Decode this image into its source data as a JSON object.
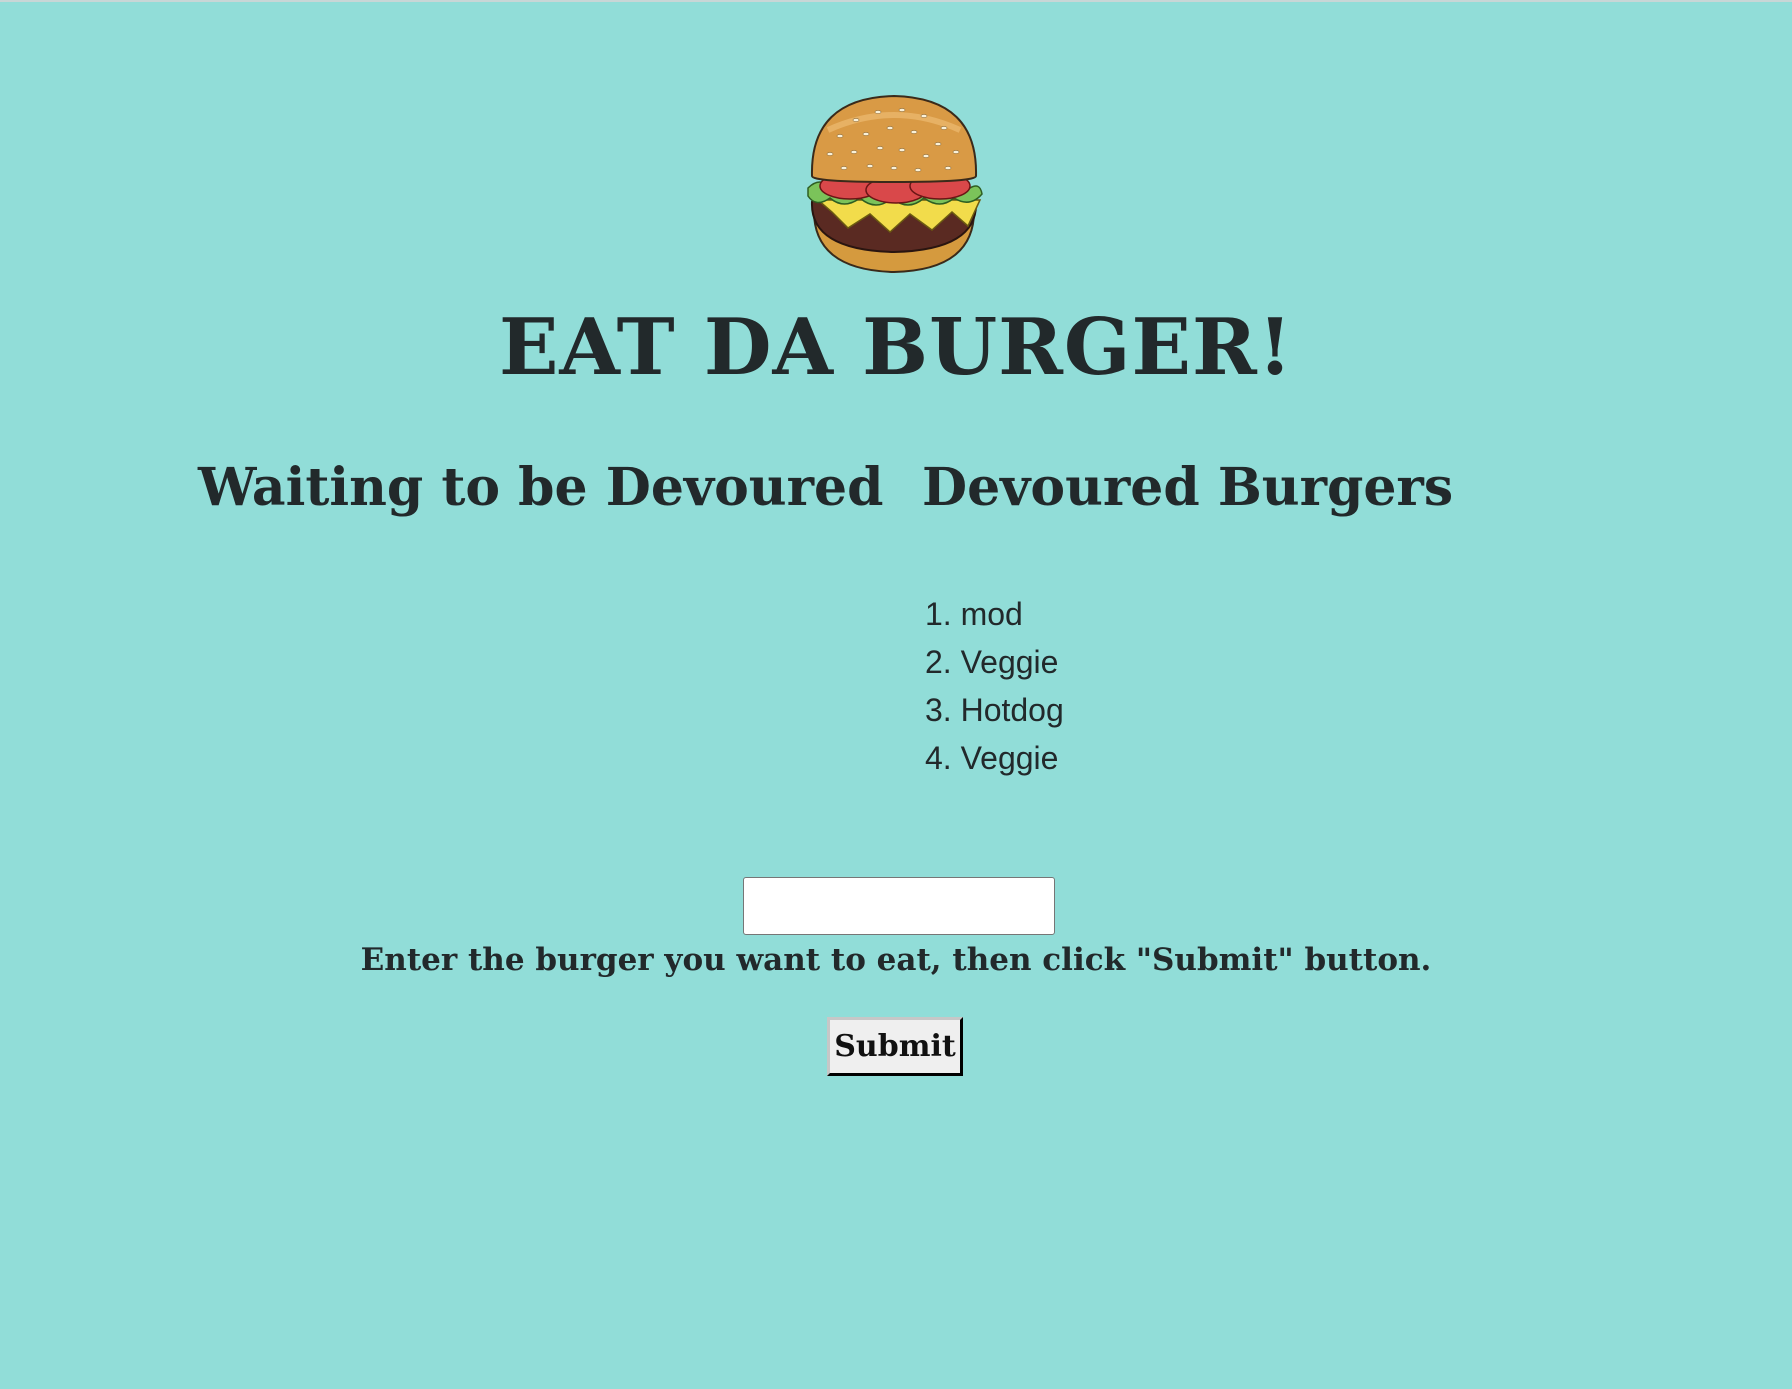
{
  "page": {
    "title": "EAT DA BURGER!",
    "background_color": "#91ddd8",
    "text_color": "#22292b"
  },
  "logo": {
    "icon": "burger-icon"
  },
  "waiting_column": {
    "heading": "Waiting to be Devoured",
    "items": []
  },
  "devoured_column": {
    "heading": "Devoured Burgers",
    "items": [
      {
        "label": "1. mod"
      },
      {
        "label": "2. Veggie"
      },
      {
        "label": "3. Hotdog"
      },
      {
        "label": "4. Veggie"
      }
    ]
  },
  "form": {
    "input_value": "",
    "instruction": "Enter the burger you want to eat, then click \"Submit\" button.",
    "submit_label": "Submit"
  }
}
